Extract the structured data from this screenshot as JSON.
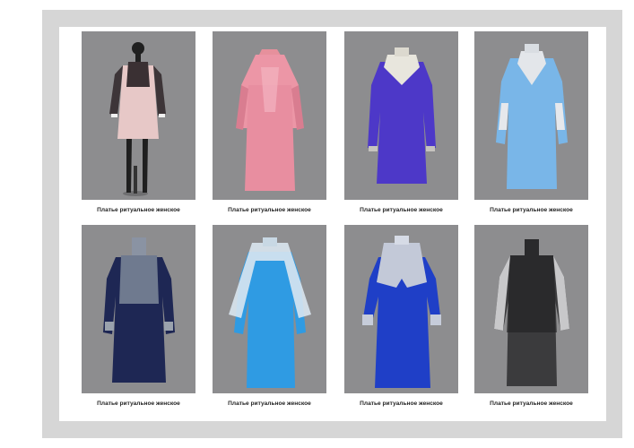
{
  "products": [
    {
      "caption": "Платье ритуальное женское",
      "image": "pink-dress-black-lace-sleeves-on-mannequin"
    },
    {
      "caption": "Платье ритуальное женское",
      "image": "pink-satin-dress-with-shawl"
    },
    {
      "caption": "Платье ритуальное женское",
      "image": "violet-dress-lace-collar"
    },
    {
      "caption": "Платье ритуальное женское",
      "image": "light-blue-dress-lace-inserts"
    },
    {
      "caption": "Платье ритуальное женское",
      "image": "navy-dress-gold-brocade-yoke"
    },
    {
      "caption": "Платье ритуальное женское",
      "image": "blue-dress-white-lace-shawl"
    },
    {
      "caption": "Платье ритуальное женское",
      "image": "royal-blue-dress-ruffled-lace-collar"
    },
    {
      "caption": "Платье ритуальное женское",
      "image": "grey-black-lace-dress"
    }
  ]
}
